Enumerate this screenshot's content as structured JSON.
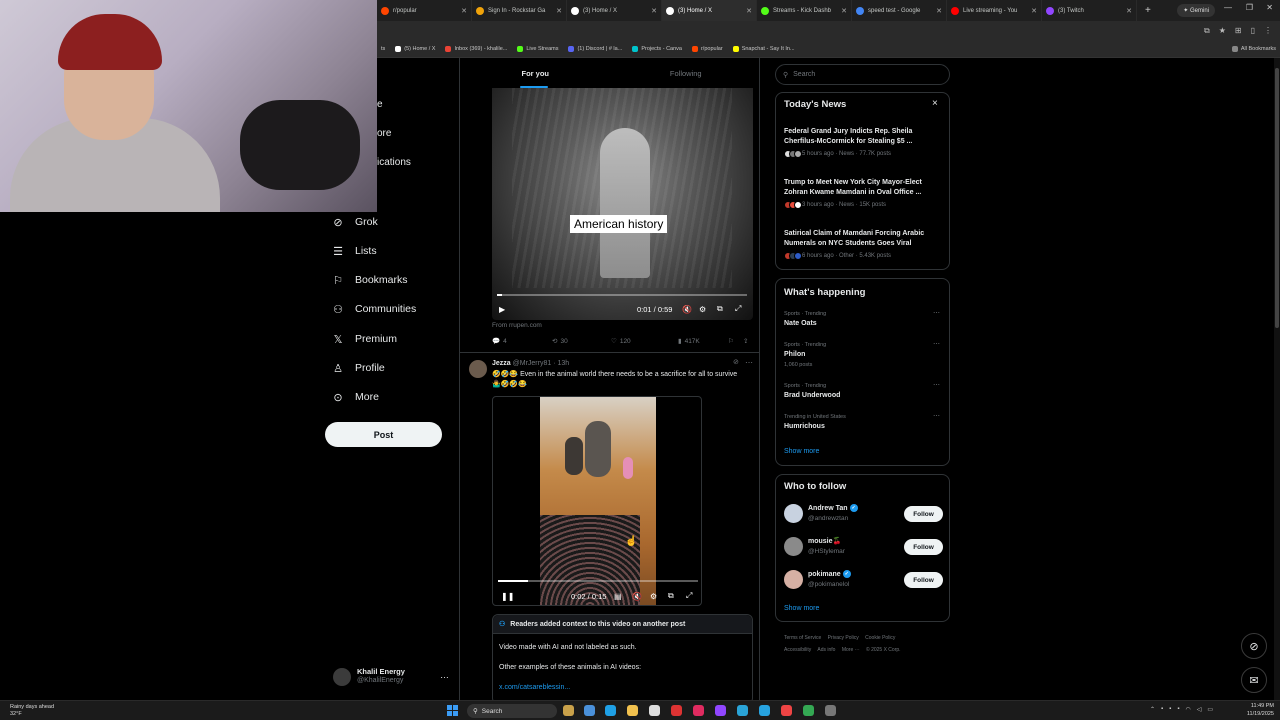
{
  "browser": {
    "tabs": [
      {
        "label": "r/popular",
        "color": "#ff4500",
        "active": false
      },
      {
        "label": "Sign In - Rockstar Ga",
        "color": "#f0a30a",
        "active": false
      },
      {
        "label": "(3) Home / X",
        "color": "#ffffff",
        "active": false
      },
      {
        "label": "(3) Home / X",
        "color": "#ffffff",
        "active": true
      },
      {
        "label": "Streams - Kick Dashb",
        "color": "#53fc18",
        "active": false
      },
      {
        "label": "speed test - Google",
        "color": "#4285f4",
        "active": false
      },
      {
        "label": "Live streaming - You",
        "color": "#ff0000",
        "active": false
      },
      {
        "label": "(3) Twitch",
        "color": "#9146ff",
        "active": false
      }
    ],
    "new_tab": "+",
    "gemini_label": "Gemini",
    "bookmarks": [
      {
        "label": "ts",
        "color": "#888888"
      },
      {
        "label": "(5) Home / X",
        "color": "#ffffff"
      },
      {
        "label": "Inbox (369) - khalile...",
        "color": "#ea4335"
      },
      {
        "label": "Live Streams",
        "color": "#53fc18"
      },
      {
        "label": "(1) Discord | # la...",
        "color": "#5865f2"
      },
      {
        "label": "Projects - Canva",
        "color": "#00c4cc"
      },
      {
        "label": "r/popular",
        "color": "#ff4500"
      },
      {
        "label": "Snapchat - Say It In...",
        "color": "#fffc00"
      }
    ],
    "all_bookmarks": "All Bookmarks"
  },
  "nav": {
    "cut_items": [
      "e",
      "ore",
      "ications"
    ],
    "items": [
      {
        "label": "Grok",
        "icon": "grok-icon"
      },
      {
        "label": "Lists",
        "icon": "lists-icon"
      },
      {
        "label": "Bookmarks",
        "icon": "bookmark-icon"
      },
      {
        "label": "Communities",
        "icon": "communities-icon"
      },
      {
        "label": "Premium",
        "icon": "x-logo-icon"
      },
      {
        "label": "Profile",
        "icon": "profile-icon"
      },
      {
        "label": "More",
        "icon": "more-circle-icon"
      }
    ],
    "post_button": "Post",
    "account": {
      "name": "Khalil Energy",
      "handle": "@KhalilEnergy",
      "more": "…"
    }
  },
  "feed": {
    "tabs": [
      "For you",
      "Following"
    ],
    "tweet1": {
      "video_caption": "American history",
      "time": "0:01 / 0:59",
      "progress": 0.02,
      "source": "From rrupen.com",
      "replies": "4",
      "reposts": "30",
      "likes": "120",
      "views": "417K"
    },
    "tweet2": {
      "name": "Jezza",
      "handle": "@MrJerry81",
      "time": "· 13h",
      "text": "🤣🤣😂 Even in the animal world there needs to be a sacrifice for all to survive 🤷‍♂️🤣🤣😂",
      "video_time": "0:02 / 0:15",
      "progress": 0.15,
      "context": {
        "header": "Readers added context to this video on another post",
        "line1": "Video made with AI and not labeled as such.",
        "line2": "Other examples of these animals in AI videos:",
        "link": "x.com/catsareblessin..."
      }
    }
  },
  "sidebar": {
    "search_placeholder": "Search",
    "todays_news": {
      "title": "Today's News",
      "close": "×",
      "items": [
        {
          "headline": "Federal Grand Jury Indicts Rep. Sheila Cherfilus-McCormick for Stealing $5 ...",
          "meta": "5 hours ago · News · 77.7K posts"
        },
        {
          "headline": "Trump to Meet New York City Mayor-Elect Zohran Kwame Mamdani in Oval Office ...",
          "meta": "3 hours ago · News · 15K posts"
        },
        {
          "headline": "Satirical Claim of Mamdani Forcing Arabic Numerals on NYC Students Goes Viral",
          "meta": "6 hours ago · Other · 5.43K posts"
        }
      ]
    },
    "happening": {
      "title": "What's happening",
      "items": [
        {
          "category": "Sports · Trending",
          "name": "Nate Oats",
          "posts": ""
        },
        {
          "category": "Sports · Trending",
          "name": "Philon",
          "posts": "1,060 posts"
        },
        {
          "category": "Sports · Trending",
          "name": "Brad Underwood",
          "posts": ""
        },
        {
          "category": "Trending in United States",
          "name": "Humrichous",
          "posts": ""
        }
      ],
      "show_more": "Show more"
    },
    "who_to_follow": {
      "title": "Who to follow",
      "items": [
        {
          "name": "Andrew Tan",
          "handle": "@andrewztan",
          "verified": true,
          "follow": "Follow",
          "avatar_color": "#c8d2e0"
        },
        {
          "name": "mousie🍒",
          "handle": "@HStylemar",
          "verified": false,
          "follow": "Follow",
          "avatar_color": "#8a8a8a"
        },
        {
          "name": "pokimane",
          "handle": "@pokimanelol",
          "verified": true,
          "follow": "Follow",
          "avatar_color": "#d6b0a4"
        }
      ],
      "show_more": "Show more"
    },
    "footer": [
      "Terms of Service",
      "Privacy Policy",
      "Cookie Policy",
      "Accessibility",
      "Ads info",
      "More ···",
      "© 2025 X Corp."
    ]
  },
  "taskbar": {
    "weather_line1": "Rainy days ahead",
    "weather_line2": "32°F",
    "search": "Search",
    "time": "11:49 PM",
    "date": "11/19/2025"
  }
}
